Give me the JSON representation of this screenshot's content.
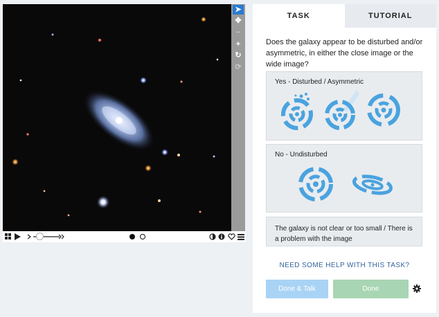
{
  "viewer": {
    "tools": [
      "pointer-icon",
      "pan-icon",
      "zoom-out-icon",
      "zoom-in-icon",
      "rotate-icon",
      "reset-icon"
    ],
    "tool_glyphs": {
      "pointer": "➤",
      "pan": "✥",
      "zoom_out": "−",
      "zoom_in": "+",
      "rotate": "↻",
      "reset": "⟳"
    },
    "colors": {
      "active_tool": "#2b7bd1",
      "toolstrip": "#9b9b9b"
    }
  },
  "tabs": {
    "task": "TASK",
    "tutorial": "TUTORIAL"
  },
  "question": "Does the galaxy appear to be disturbed and/or asymmetric, in either the close image or the wide image?",
  "answers": [
    {
      "label": "Yes - Disturbed / Asymmetric"
    },
    {
      "label": "No - Undisturbed"
    },
    {
      "label": "The galaxy is not clear or too small / There is a problem with the image"
    }
  ],
  "help_link": "NEED SOME HELP WITH THIS TASK?",
  "buttons": {
    "done_talk": "Done & Talk",
    "done": "Done",
    "done_talk_color": "#a9d3f5",
    "done_color": "#a8d5b3"
  },
  "icon_color": "#4aa3df"
}
